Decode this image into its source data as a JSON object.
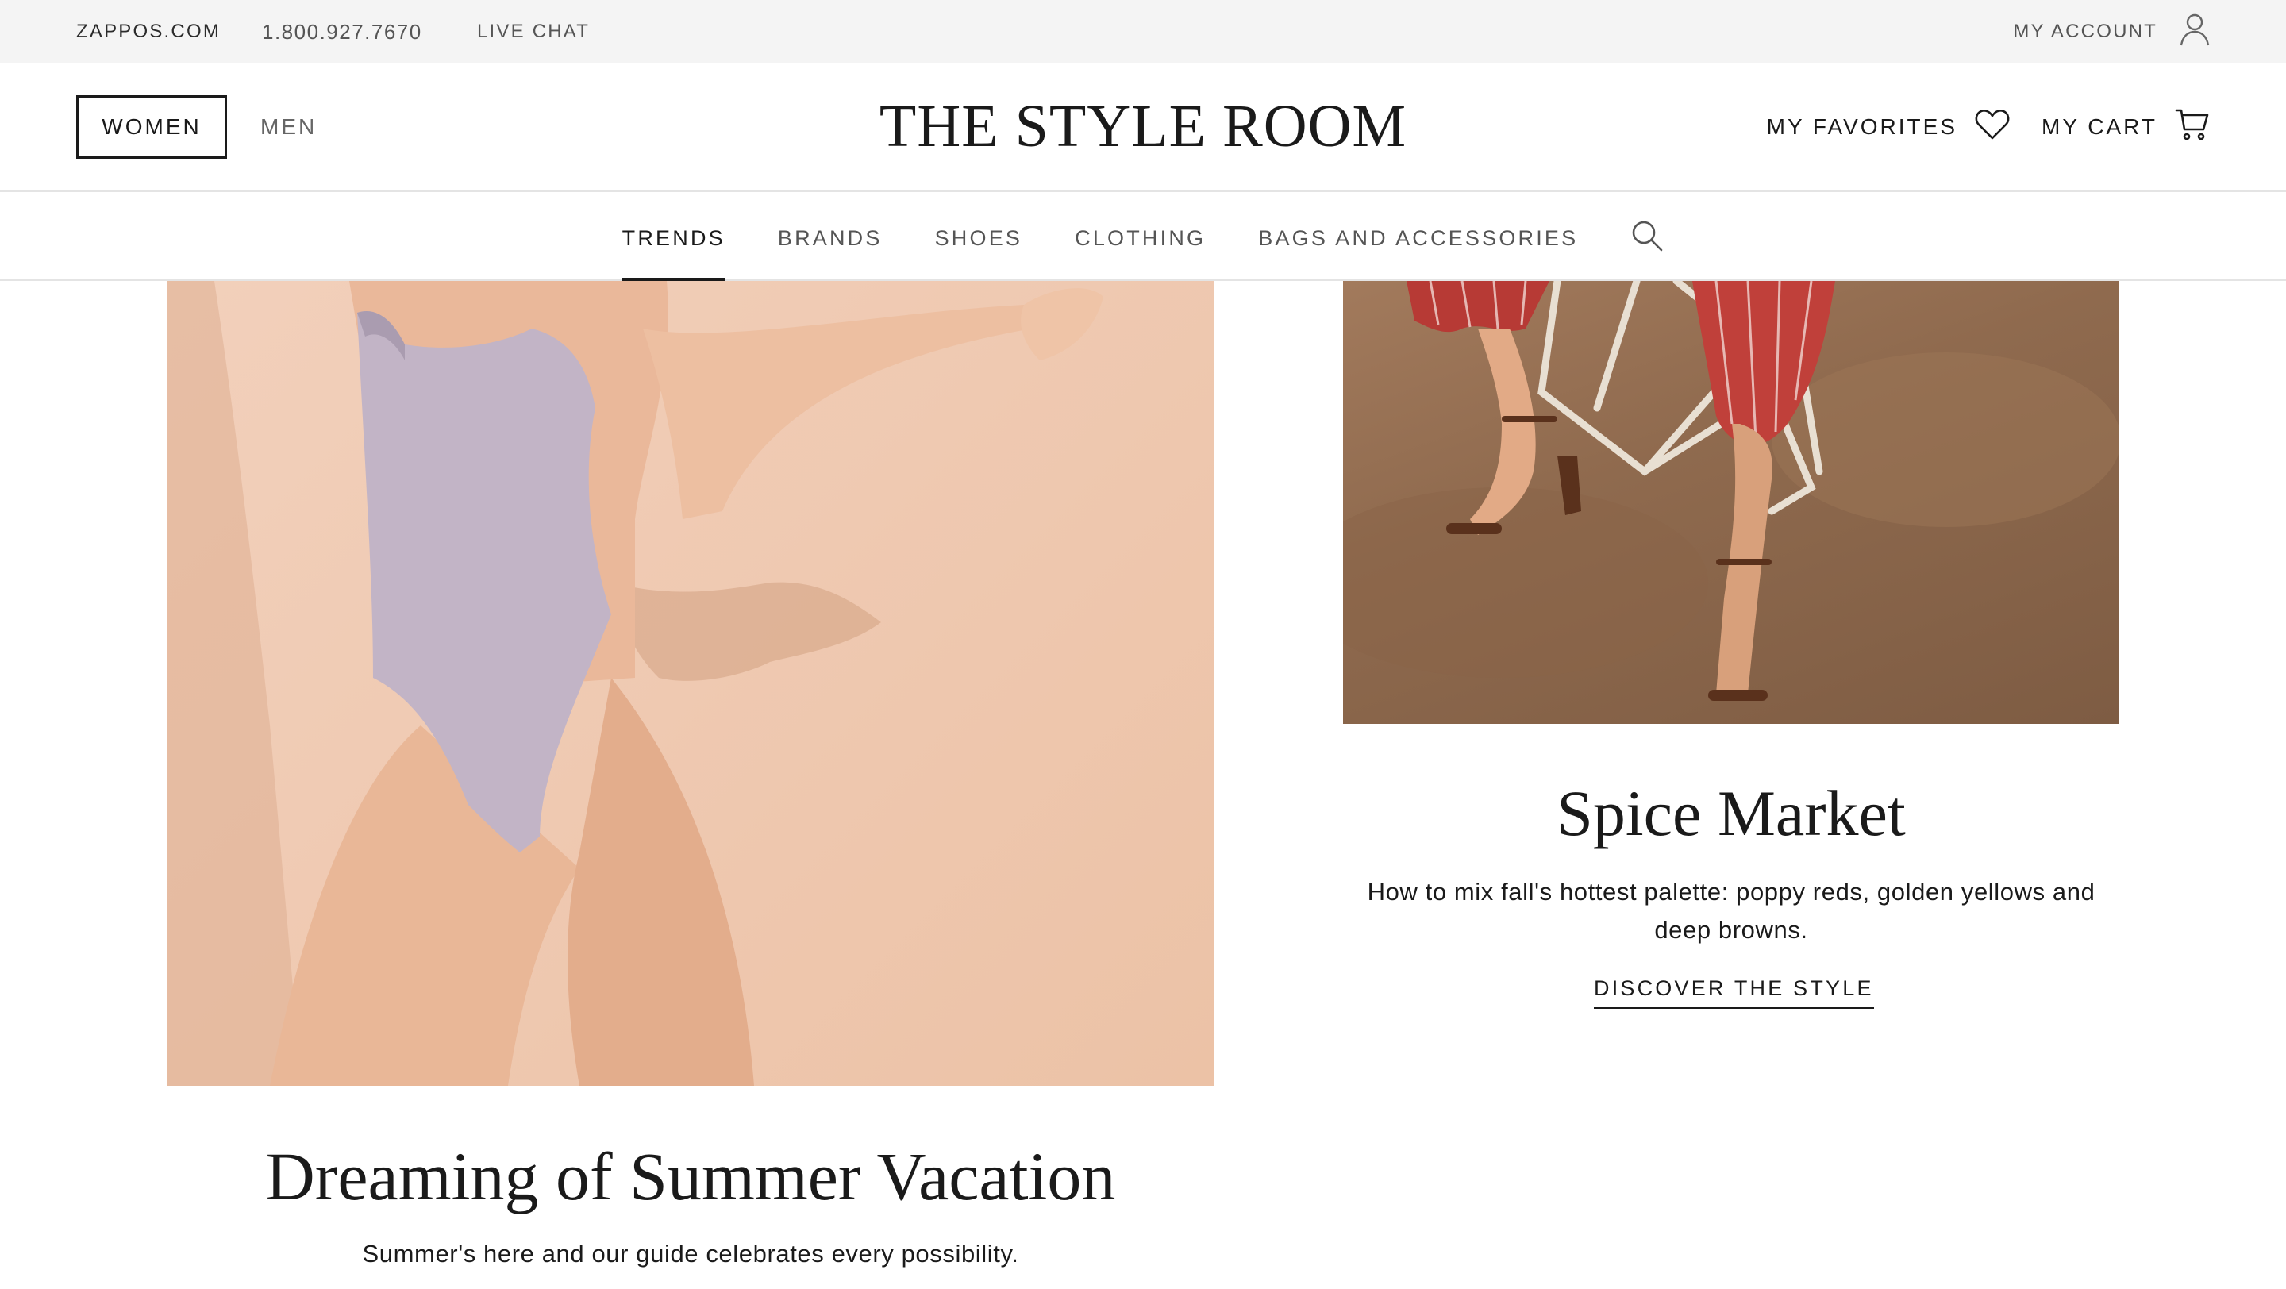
{
  "utility_bar": {
    "site_link": "ZAPPOS.COM",
    "phone": "1.800.927.7670",
    "live_chat": "LIVE CHAT",
    "my_account": "MY ACCOUNT",
    "account_icon": "user-icon"
  },
  "header": {
    "gender_tabs": [
      {
        "label": "WOMEN",
        "selected": true
      },
      {
        "label": "MEN",
        "selected": false
      }
    ],
    "logo": "THE STYLE ROOM",
    "favorites": {
      "label": "MY FAVORITES",
      "icon": "heart-icon"
    },
    "cart": {
      "label": "MY CART",
      "icon": "cart-icon"
    }
  },
  "nav": {
    "tabs": [
      {
        "label": "TRENDS",
        "active": true
      },
      {
        "label": "BRANDS",
        "active": false
      },
      {
        "label": "SHOES",
        "active": false
      },
      {
        "label": "CLOTHING",
        "active": false
      },
      {
        "label": "BAGS AND ACCESSORIES",
        "active": false
      }
    ],
    "search_icon": "search-icon"
  },
  "articles": [
    {
      "title": "Dreaming of Summer Vacation",
      "description": "Summer's here and our guide celebrates every possibility.",
      "image": "swimsuit-photo"
    },
    {
      "title": "Spice Market",
      "description": "How to mix fall's hottest palette: poppy reds, golden yellows and deep browns.",
      "cta": "DISCOVER THE STYLE",
      "image": "red-trousers-sandals-photo"
    }
  ],
  "colors": {
    "utility_bg": "#f4f4f4",
    "text": "#1a1a1a",
    "muted": "#555555",
    "divider": "#e4e4e4"
  }
}
